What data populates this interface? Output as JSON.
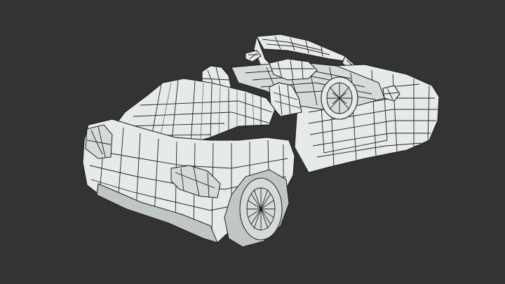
{
  "viewport": {
    "background": "#333333",
    "mesh_fill": "#e6ebea",
    "wire_color": "#222222"
  },
  "model": {
    "icon": "car-wireframe-icon",
    "render_mode": "wireframe-on-shaded"
  }
}
